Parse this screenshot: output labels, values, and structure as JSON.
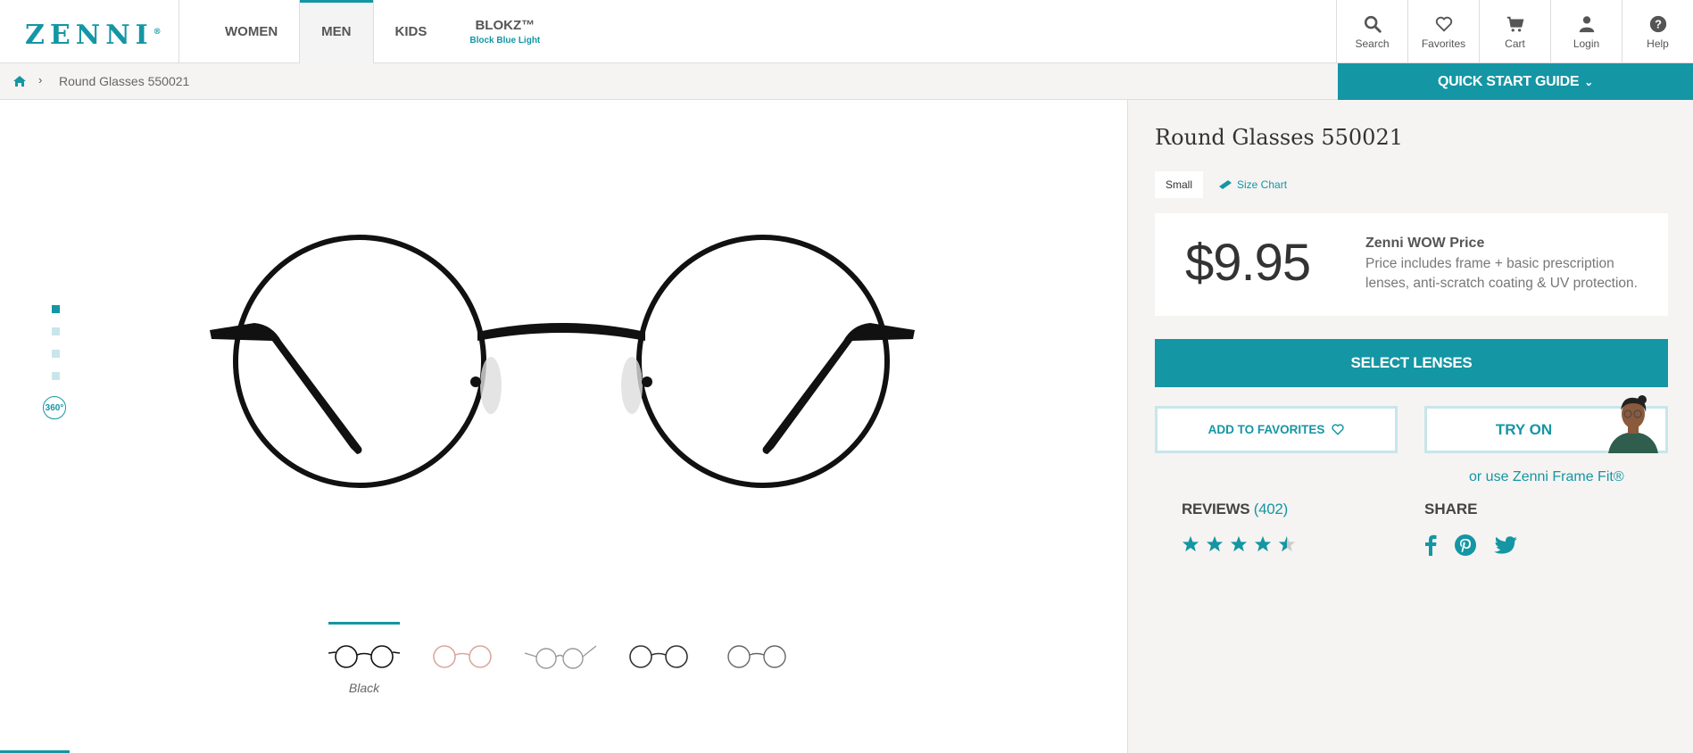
{
  "header": {
    "logo": "ZENNI",
    "nav": [
      {
        "label": "WOMEN",
        "sub": ""
      },
      {
        "label": "MEN",
        "sub": ""
      },
      {
        "label": "KIDS",
        "sub": ""
      },
      {
        "label": "BLOKZ™",
        "sub": "Block Blue Light"
      }
    ],
    "active_nav": "MEN",
    "icons": [
      {
        "label": "Search",
        "icon": "search-icon"
      },
      {
        "label": "Favorites",
        "icon": "heart-icon"
      },
      {
        "label": "Cart",
        "icon": "cart-icon"
      },
      {
        "label": "Login",
        "icon": "user-icon"
      },
      {
        "label": "Help",
        "icon": "help-icon"
      }
    ]
  },
  "breadcrumb": {
    "home_icon": "home-icon",
    "current": "Round Glasses 550021"
  },
  "quick_start": "QUICK START GUIDE",
  "gallery": {
    "rotate_label": "360°",
    "active_color": "Black",
    "swatch_count": 5
  },
  "product": {
    "title": "Round Glasses 550021",
    "size": "Small",
    "size_chart": "Size Chart",
    "price": "$9.95",
    "wow_title": "Zenni WOW Price",
    "wow_desc": "Price includes frame + basic prescription lenses, anti-scratch coating & UV protection.",
    "select_lenses": "SELECT LENSES",
    "add_favorites": "ADD TO FAVORITES",
    "try_on": "TRY ON",
    "frame_fit": "or use Zenni Frame Fit®",
    "reviews_label": "REVIEWS",
    "reviews_count": "(402)",
    "rating": 4.5,
    "share_label": "SHARE"
  },
  "colors": {
    "accent": "#1496a4",
    "panel_bg": "#f5f4f2"
  }
}
